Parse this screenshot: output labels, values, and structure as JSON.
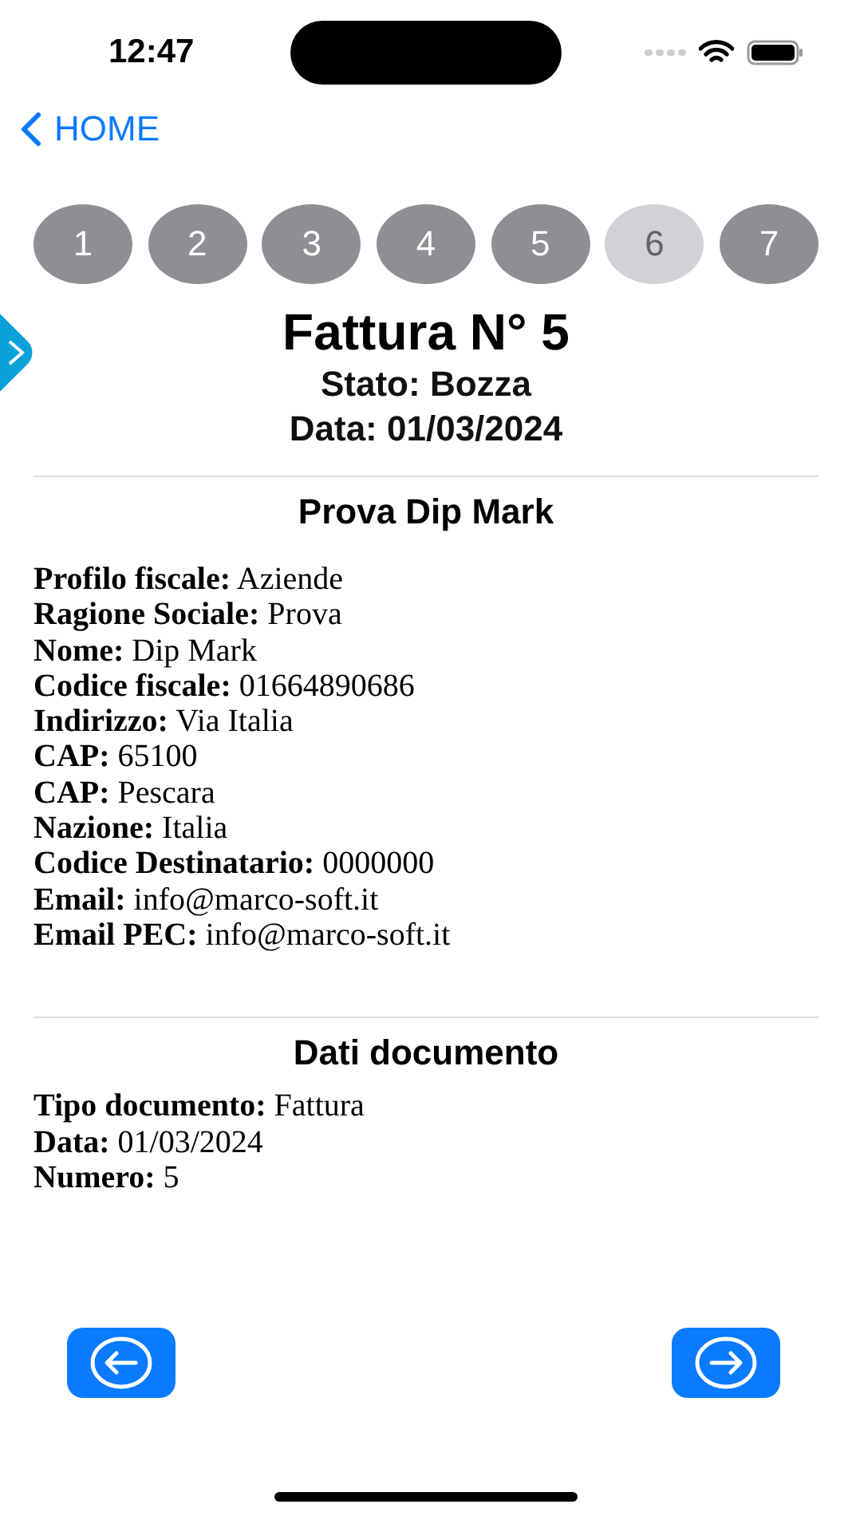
{
  "status_bar": {
    "time": "12:47"
  },
  "nav": {
    "back_label": "HOME"
  },
  "steps": [
    {
      "label": "1",
      "selected": false
    },
    {
      "label": "2",
      "selected": false
    },
    {
      "label": "3",
      "selected": false
    },
    {
      "label": "4",
      "selected": false
    },
    {
      "label": "5",
      "selected": false
    },
    {
      "label": "6",
      "selected": true
    },
    {
      "label": "7",
      "selected": false
    }
  ],
  "header": {
    "title": "Fattura N° 5",
    "status": "Stato: Bozza",
    "date": "Data: 01/03/2024"
  },
  "sections": [
    {
      "title": "Prova Dip Mark",
      "lines": [
        "**Profilo fiscale:** Aziende",
        "**Ragione Sociale:** Prova",
        "**Nome:** Dip Mark",
        "**Codice fiscale:** 01664890686",
        "**Indirizzo:** Via Italia",
        "**CAP:** 65100",
        "**CAP:** Pescara",
        "**Nazione:** Italia",
        "**Codice Destinatario:** 0000000",
        "**Email:** info@marco-soft.it",
        "**Email PEC:** info@marco-soft.it"
      ]
    },
    {
      "title": "Dati documento",
      "lines": [
        "**Tipo documento:** Fattura",
        "**Data:** 01/03/2024",
        "**Numero:** 5"
      ]
    }
  ]
}
